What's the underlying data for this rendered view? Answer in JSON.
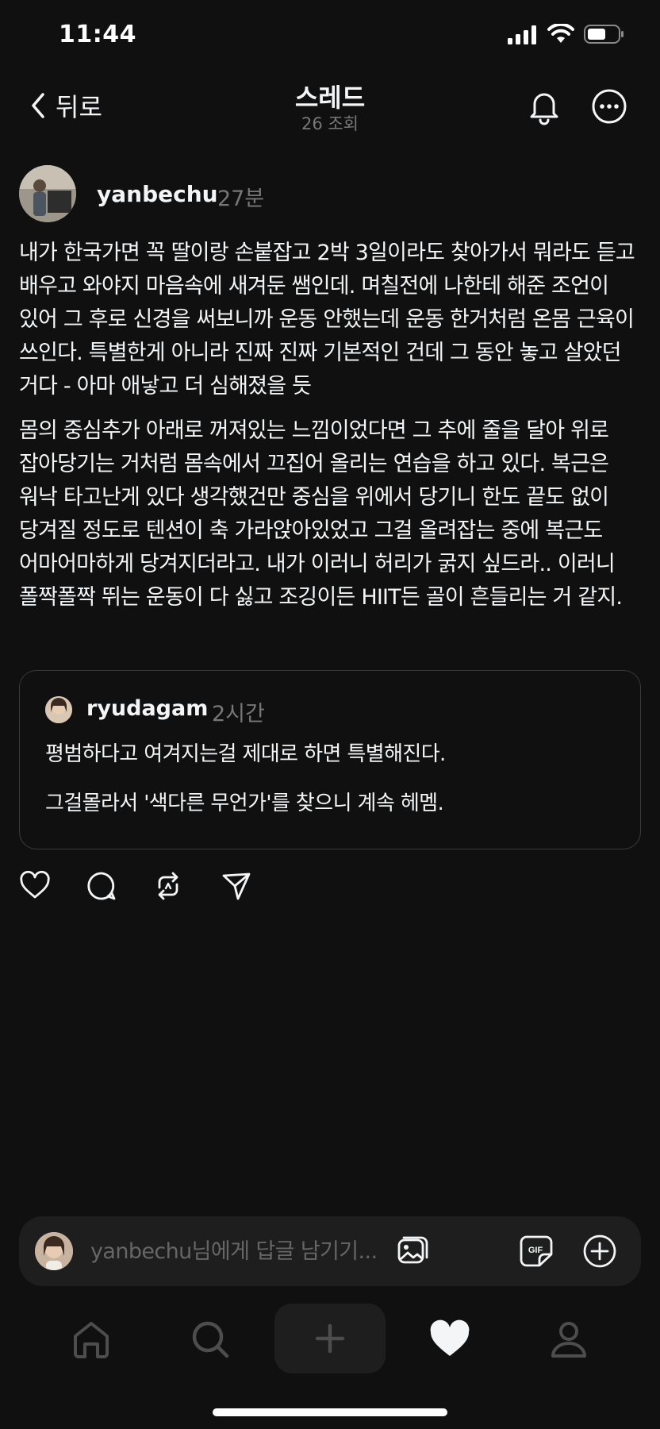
{
  "status": {
    "time": "11:44"
  },
  "header": {
    "back_label": "뒤로",
    "title": "스레드",
    "views": "26 조회"
  },
  "post": {
    "username": "yanbechu",
    "time": "27분",
    "paragraphs": [
      "내가 한국가면 꼭 딸이랑 손붙잡고 2박 3일이라도 찾아가서 뭐라도 듣고 배우고 와야지 마음속에 새겨둔 쌤인데. 며칠전에 나한테 해준 조언이 있어 그 후로 신경을 써보니까 운동 안했는데 운동 한거처럼 온몸 근육이 쓰인다. 특별한게 아니라 진짜 진짜 기본적인 건데 그 동안 놓고 살았던 거다 - 아마 애낳고 더 심해졌을 듯",
      "몸의 중심추가 아래로 꺼져있는 느낌이었다면 그 추에 줄을 달아 위로 잡아당기는 거처럼 몸속에서 끄집어 올리는 연습을 하고 있다. 복근은 워낙 타고난게 있다 생각했건만 중심을 위에서 당기니 한도 끝도 없이 당겨질 정도로 텐션이 축 가라앉아있었고 그걸 올려잡는 중에 복근도 어마어마하게 당겨지더라고. 내가 이러니 허리가 굵지 싶드라.. 이러니 폴짝폴짝 뛰는 운동이 다 싫고 조깅이든 HIIT든 골이 흔들리는 거 같지."
    ]
  },
  "quote": {
    "username": "ryudagam",
    "time": "2시간",
    "line1": "평범하다고 여겨지는걸 제대로 하면 특별해진다.",
    "line2": "그걸몰라서 '색다른 무언가'를 찾으니 계속 헤멤."
  },
  "reply": {
    "placeholder": "yanbechu님에게 답글 남기기...",
    "value": ""
  },
  "icons": {
    "back": "chevron-left-icon",
    "bell": "bell-icon",
    "more": "more-icon",
    "like": "heart-icon",
    "comment": "comment-icon",
    "repost": "repost-icon",
    "share": "send-icon",
    "image": "image-icon",
    "gif": "gif-icon",
    "add": "plus-circle-icon",
    "home": "home-icon",
    "search": "search-icon",
    "create": "plus-icon",
    "activity": "heart-filled-icon",
    "profile": "profile-icon"
  },
  "colors": {
    "background": "#101010",
    "text": "#f3f5f7",
    "muted": "#777777",
    "border": "#3a3a3a",
    "surface": "#1e1e1e"
  }
}
